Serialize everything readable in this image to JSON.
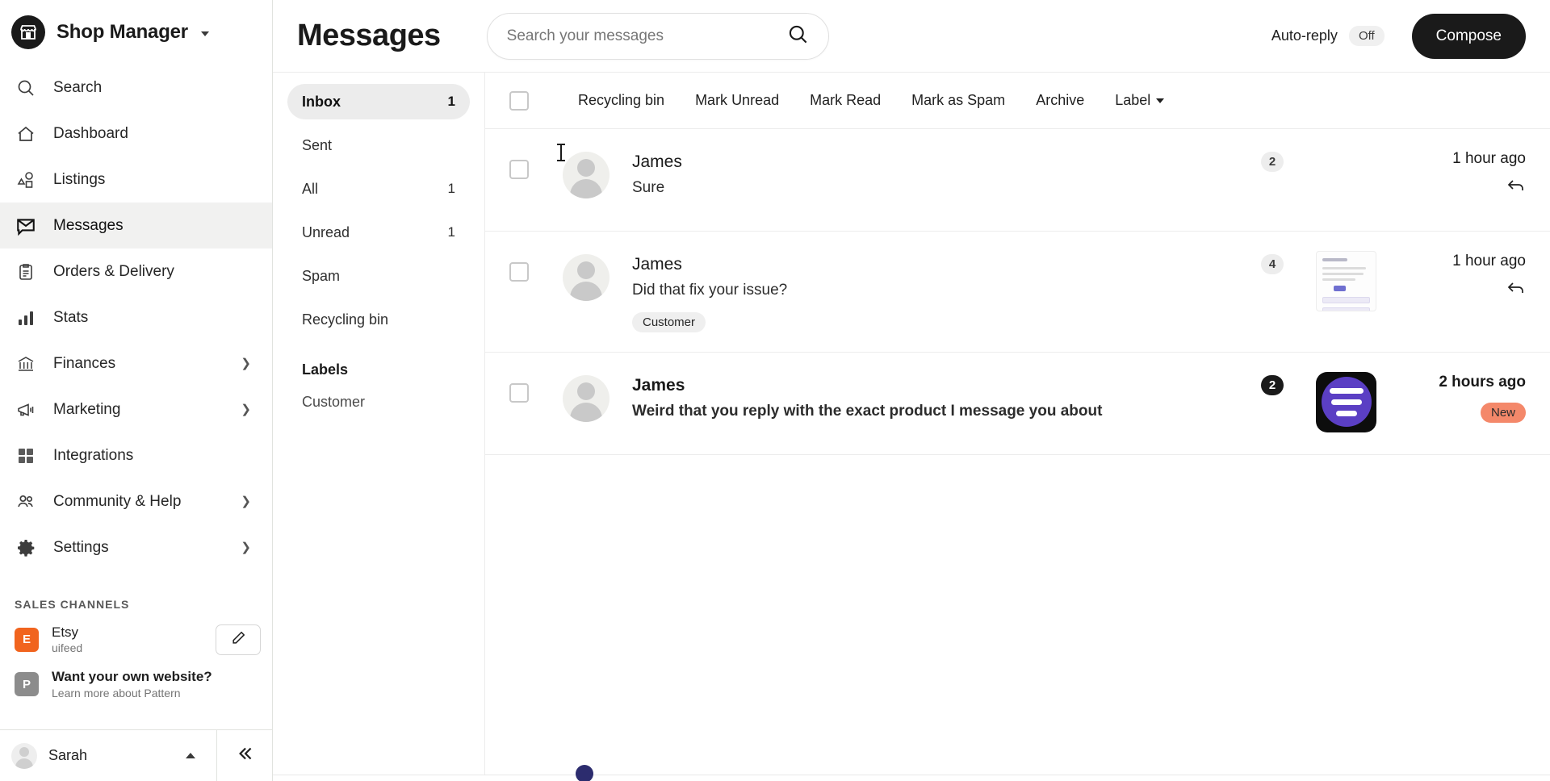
{
  "sidebar": {
    "brand": {
      "name": "Shop Manager",
      "logo_icon": "storefront-icon",
      "caret_icon": "chevron-down-icon"
    },
    "items": [
      {
        "label": "Search",
        "icon": "search-icon",
        "active": false,
        "expandable": false
      },
      {
        "label": "Dashboard",
        "icon": "home-icon",
        "active": false,
        "expandable": false
      },
      {
        "label": "Listings",
        "icon": "shapes-icon",
        "active": false,
        "expandable": false
      },
      {
        "label": "Messages",
        "icon": "envelope-chat-icon",
        "active": true,
        "expandable": false
      },
      {
        "label": "Orders & Delivery",
        "icon": "clipboard-icon",
        "active": false,
        "expandable": false
      },
      {
        "label": "Stats",
        "icon": "bar-chart-icon",
        "active": false,
        "expandable": false
      },
      {
        "label": "Finances",
        "icon": "bank-icon",
        "active": false,
        "expandable": true
      },
      {
        "label": "Marketing",
        "icon": "megaphone-icon",
        "active": false,
        "expandable": true
      },
      {
        "label": "Integrations",
        "icon": "grid-icon",
        "active": false,
        "expandable": false
      },
      {
        "label": "Community & Help",
        "icon": "people-icon",
        "active": false,
        "expandable": true
      },
      {
        "label": "Settings",
        "icon": "gear-icon",
        "active": false,
        "expandable": true
      }
    ],
    "sales_channels_heading": "SALES CHANNELS",
    "channels": [
      {
        "badge_letter": "E",
        "badge_color": "#f1641e",
        "title": "Etsy",
        "subtitle": "uifeed",
        "bold_title": false,
        "has_edit": true,
        "edit_icon": "pencil-icon"
      },
      {
        "badge_letter": "P",
        "badge_color": "#8c8c8c",
        "title": "Want your own website?",
        "subtitle": "Learn more about Pattern",
        "bold_title": true,
        "has_edit": false,
        "edit_icon": ""
      }
    ],
    "user": {
      "name": "Sarah",
      "avatar_icon": "user-avatar",
      "caret_icon": "chevron-up-icon"
    },
    "collapse_icon": "chevrons-left-icon"
  },
  "header": {
    "title": "Messages",
    "search": {
      "placeholder": "Search your messages",
      "value": "",
      "icon": "search-icon"
    },
    "auto_reply_label": "Auto-reply",
    "auto_reply_state": "Off",
    "compose_label": "Compose"
  },
  "folders": {
    "items": [
      {
        "label": "Inbox",
        "count": "1",
        "active": true
      },
      {
        "label": "Sent",
        "count": "",
        "active": false
      },
      {
        "label": "All",
        "count": "1",
        "active": false
      },
      {
        "label": "Unread",
        "count": "1",
        "active": false
      },
      {
        "label": "Spam",
        "count": "",
        "active": false
      },
      {
        "label": "Recycling bin",
        "count": "",
        "active": false
      }
    ],
    "labels_heading": "Labels",
    "labels": [
      {
        "label": "Customer"
      }
    ]
  },
  "toolbar": {
    "select_all_icon": "checkbox-unchecked-icon",
    "actions": [
      {
        "label": "Recycling bin",
        "has_caret": false
      },
      {
        "label": "Mark Unread",
        "has_caret": false
      },
      {
        "label": "Mark Read",
        "has_caret": false
      },
      {
        "label": "Mark as Spam",
        "has_caret": false
      },
      {
        "label": "Archive",
        "has_caret": false
      },
      {
        "label": "Label",
        "has_caret": true
      }
    ]
  },
  "messages": [
    {
      "sender": "James",
      "preview": "Sure",
      "tag": "",
      "count": "2",
      "count_style": "light",
      "thumbnail": "none",
      "time": "1 hour ago",
      "unread": false,
      "reply_icon": "reply-arrow-icon",
      "status_pill": ""
    },
    {
      "sender": "James",
      "preview": "Did that fix your issue?",
      "tag": "Customer",
      "count": "4",
      "count_style": "light",
      "thumbnail": "document",
      "time": "1 hour ago",
      "unread": false,
      "reply_icon": "reply-arrow-icon",
      "status_pill": ""
    },
    {
      "sender": "James",
      "preview": "Weird that you reply with the exact product I message you about",
      "tag": "",
      "count": "2",
      "count_style": "dark",
      "thumbnail": "app-purple",
      "time": "2 hours ago",
      "unread": true,
      "reply_icon": "",
      "status_pill": "New"
    }
  ],
  "colors": {
    "accent_dark": "#1a1a1a",
    "etsy_orange": "#f1641e",
    "new_pill": "#f4886a",
    "app_purple": "#5b3fc4"
  }
}
